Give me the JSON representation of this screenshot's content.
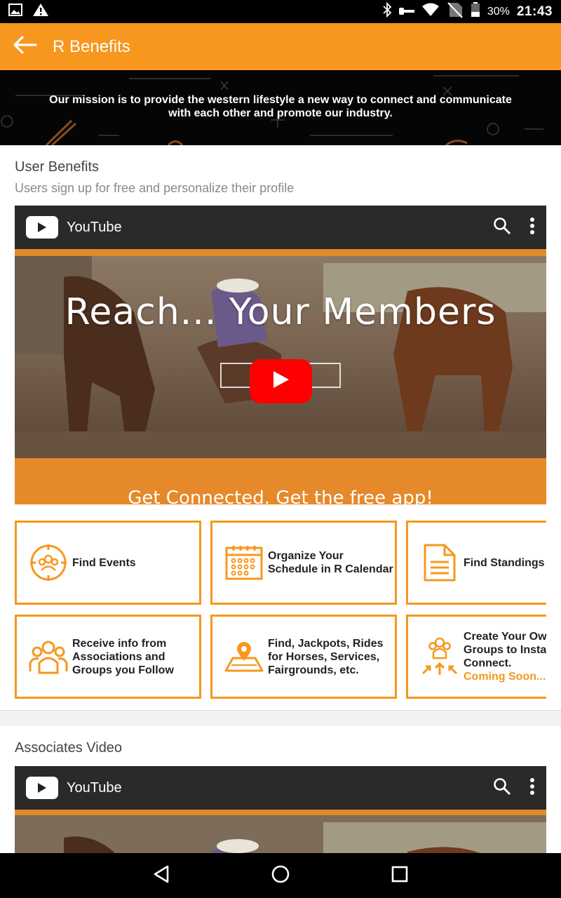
{
  "status_bar": {
    "battery_percent": "30%",
    "time": "21:43",
    "icons": [
      "image-icon",
      "warning-icon",
      "bluetooth-icon",
      "key-icon",
      "wifi-icon",
      "no-sim-icon",
      "battery-icon"
    ]
  },
  "app_bar": {
    "title": "R Benefits",
    "back_icon": "arrow-left-icon",
    "background": "#f7971e"
  },
  "mission": {
    "text": "Our mission is to provide the western lifestyle a new way to connect and communicate with each other and promote our industry."
  },
  "user_benefits": {
    "title": "User Benefits",
    "subtitle": "Users sign up for free and personalize their profile",
    "video": {
      "brand": "YouTube",
      "headline": "Reach... Your Members",
      "tagline": "Get Connected. Get the free app!"
    },
    "features": [
      {
        "label": "Find Events",
        "icon": "target-people-icon"
      },
      {
        "label": "Organize Your Schedule in R Calendar",
        "icon": "calendar-icon"
      },
      {
        "label": "Find Standings",
        "icon": "document-icon"
      },
      {
        "label": "Receive info from Associations and Groups you Follow",
        "icon": "group-icon"
      },
      {
        "label": "Find, Jackpots, Rides for Horses, Services, Fairgrounds, etc.",
        "icon": "map-pin-icon"
      },
      {
        "label": "Create Your Own Groups to Instantly Connect.",
        "icon": "group-connect-icon",
        "note": "Coming Soon..."
      }
    ]
  },
  "associates": {
    "title": "Associates Video",
    "video": {
      "brand": "YouTube"
    }
  },
  "nav_bar": {
    "icons": [
      "back-triangle-icon",
      "home-circle-icon",
      "recents-square-icon"
    ]
  },
  "colors": {
    "accent": "#f7971e",
    "youtube_red": "#ff0000"
  }
}
